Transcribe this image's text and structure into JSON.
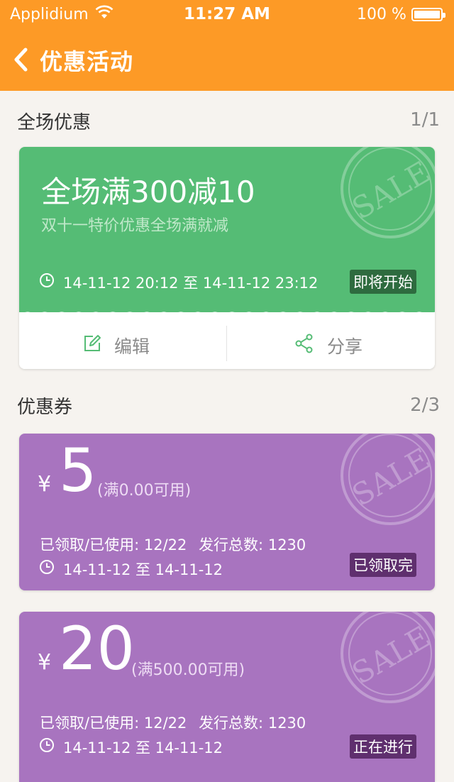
{
  "status_bar": {
    "carrier": "Applidium",
    "time": "11:27 AM",
    "battery": "100 %"
  },
  "nav": {
    "title": "优惠活动"
  },
  "promotions": {
    "section_title": "全场优惠",
    "count": "1/1",
    "card": {
      "title": "全场满300减10",
      "subtitle": "双十一特价优惠全场满就减",
      "time_range": "14-11-12 20:12 至 14-11-12 23:12",
      "status": "即将开始",
      "stamp": "SALE",
      "edit_label": "编辑",
      "share_label": "分享"
    }
  },
  "coupons": {
    "section_title": "优惠券",
    "count": "2/3",
    "currency": "¥",
    "items": [
      {
        "amount": "5",
        "condition": "(满0.00可用)",
        "claimed_used_label": "已领取/已使用:",
        "claimed_used": "12/22",
        "issued_label": "发行总数:",
        "issued": "1230",
        "date_range": "14-11-12 至 14-11-12",
        "status": "已领取完",
        "stamp": "SALE"
      },
      {
        "amount": "20",
        "condition": "(满500.00可用)",
        "claimed_used_label": "已领取/已使用:",
        "claimed_used": "12/22",
        "issued_label": "发行总数:",
        "issued": "1230",
        "date_range": "14-11-12 至 14-11-12",
        "status": "正在进行",
        "stamp": "SALE"
      }
    ]
  },
  "colors": {
    "header": "#fd9a26",
    "promo_green": "#55bc75",
    "coupon_purple": "#a874bf"
  }
}
